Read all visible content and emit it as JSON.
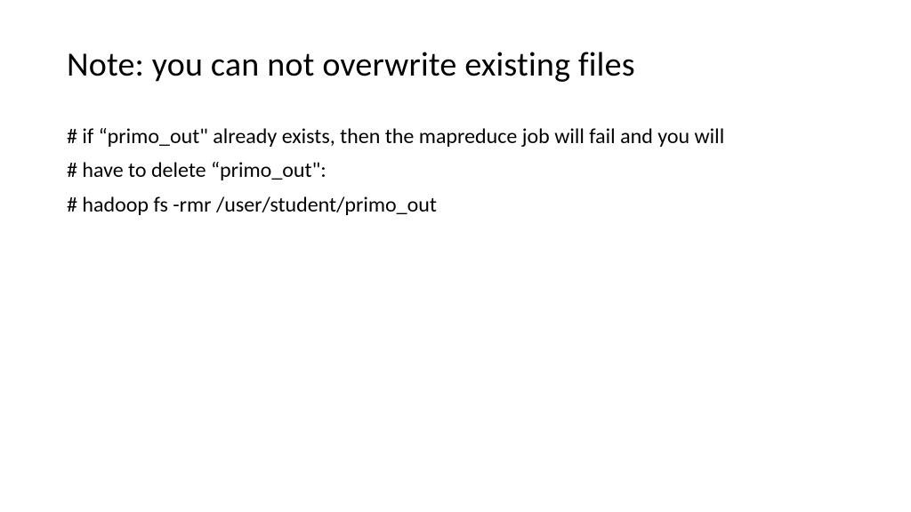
{
  "slide": {
    "title": "Note: you can not overwrite existing files",
    "lines": {
      "l1": "# if “primo_out\" already exists, then the mapreduce job will fail and you will",
      "l2": "# have to delete “primo_out\":",
      "l3": "# hadoop fs -rmr /user/student/primo_out"
    }
  }
}
